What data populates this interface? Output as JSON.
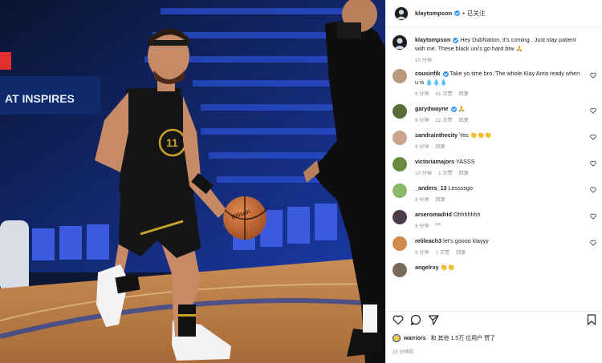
{
  "header": {
    "username": "klaytompson",
    "follow_state": "已关注",
    "separator": "•"
  },
  "caption": {
    "username": "klaytompson",
    "text": "Hey DubNation, it's coming . Just stay patient with me. These black uni's go hard btw 🙏",
    "time": "10 分钟"
  },
  "comments": [
    {
      "username": "cousinfik",
      "verified": true,
      "text": "Take yo time bro. The whole Klay Area ready when u is 💧💧💧",
      "time": "8 分钟",
      "likes": "41 次赞",
      "reply": "回复",
      "avatar_color": "#b89a7a"
    },
    {
      "username": "garydwayne",
      "verified": true,
      "text": "🙏",
      "time": "8 分钟",
      "likes": "22 次赞",
      "reply": "回复",
      "avatar_color": "#5a6b3a"
    },
    {
      "username": "sandrainthecity",
      "verified": false,
      "text": "Yes 👏👏👏",
      "time": "9 分钟",
      "likes": "",
      "reply": "回复",
      "avatar_color": "#c9a48a"
    },
    {
      "username": "victoriamajors",
      "verified": false,
      "text": "YASSS",
      "time": "10 分钟",
      "likes": "1 次赞",
      "reply": "回复",
      "avatar_color": "#6a8a3f"
    },
    {
      "username": "_anders_13",
      "verified": false,
      "text": "Lessssgo",
      "time": "9 分钟",
      "likes": "",
      "reply": "回复",
      "avatar_color": "#8ab86a"
    },
    {
      "username": "arseromadrid",
      "verified": false,
      "text": "Ohhhhhhh",
      "time": "9 分钟",
      "likes": "",
      "reply": "•••",
      "avatar_color": "#4a3a4a"
    },
    {
      "username": "relileach3",
      "verified": false,
      "text": "let's goooo klayyy",
      "time": "9 分钟",
      "likes": "1 次赞",
      "reply": "回复",
      "avatar_color": "#d08a4a"
    },
    {
      "username": "angelrxy",
      "verified": false,
      "text": "👏👏",
      "time": "",
      "likes": "",
      "reply": "",
      "avatar_color": "#7a6a5a"
    }
  ],
  "likes_line": {
    "user": "warriors",
    "text": "和 其他 1.5万 位用户 赞了"
  },
  "post_time": "10 分钟前",
  "photo": {
    "jersey_number": "11",
    "banner_text": "AT INSPIRES",
    "ball_text": "Wilson"
  },
  "colors": {
    "accent_blue": "#3897f0",
    "text": "#262626",
    "muted": "#8e8e8e",
    "jersey": "#111111",
    "jersey_gold": "#c9a227"
  }
}
